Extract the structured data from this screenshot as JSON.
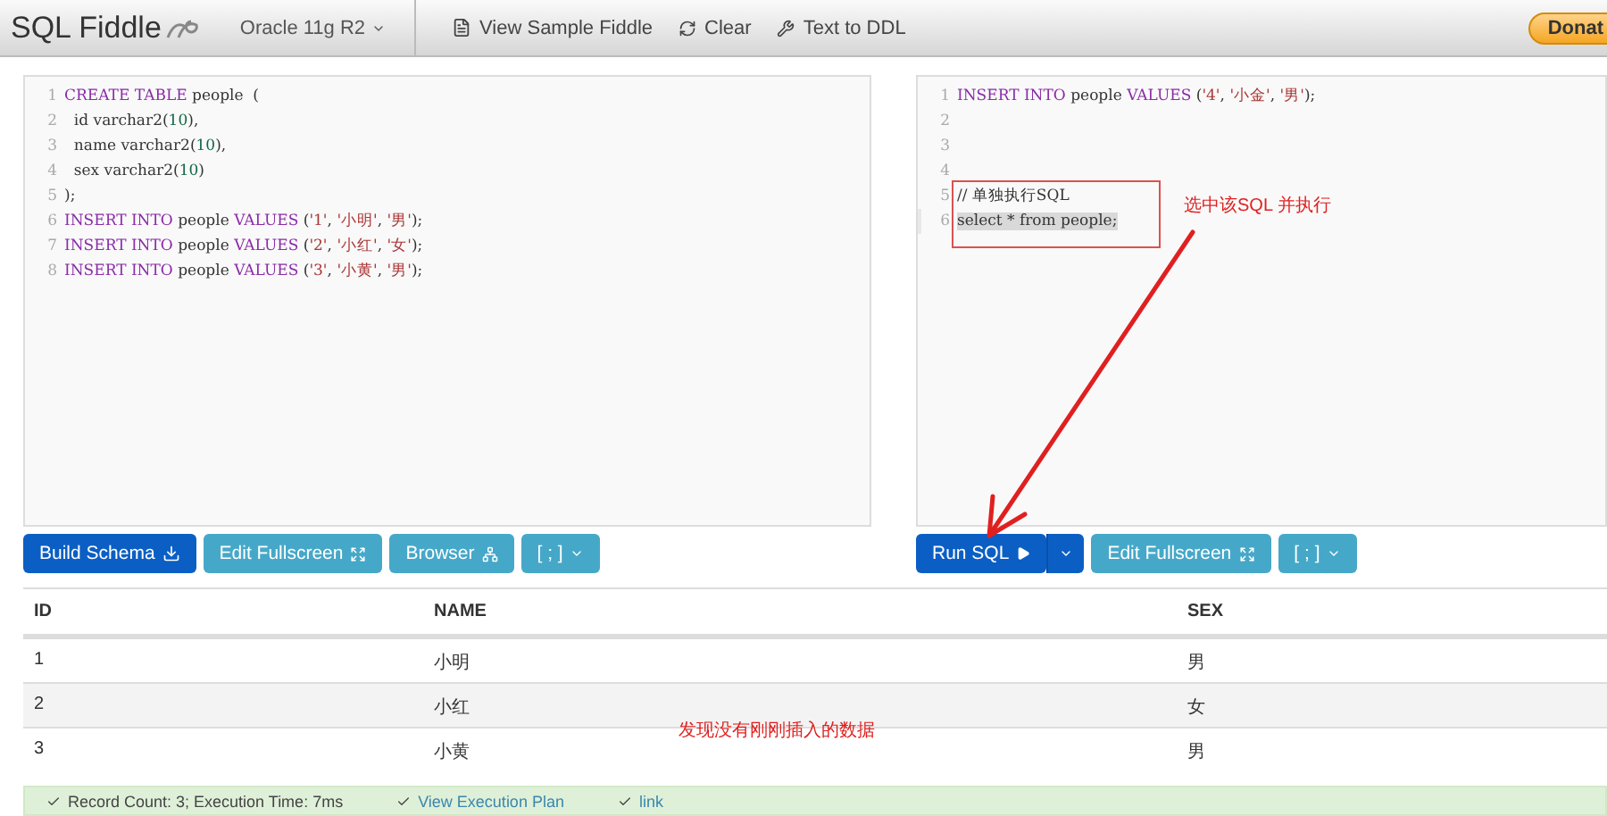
{
  "navbar": {
    "brand": "SQL Fiddle",
    "database": "Oracle 11g R2",
    "links": [
      {
        "kind": "sample",
        "label": "View Sample Fiddle"
      },
      {
        "kind": "clear",
        "label": "Clear"
      },
      {
        "kind": "ddl",
        "label": "Text to DDL"
      }
    ],
    "donate": "Donat"
  },
  "schema_panel": {
    "lines": [
      {
        "number": "1",
        "selected": false,
        "tokens": [
          {
            "kind": "keyword",
            "text": "CREATE TABLE"
          },
          {
            "kind": "plain",
            "text": " people  ("
          }
        ]
      },
      {
        "number": "2",
        "selected": false,
        "tokens": [
          {
            "kind": "plain",
            "text": "  id varchar2("
          },
          {
            "kind": "number",
            "text": "10"
          },
          {
            "kind": "plain",
            "text": "),"
          }
        ]
      },
      {
        "number": "3",
        "selected": false,
        "tokens": [
          {
            "kind": "plain",
            "text": "  name varchar2("
          },
          {
            "kind": "number",
            "text": "10"
          },
          {
            "kind": "plain",
            "text": "),"
          }
        ]
      },
      {
        "number": "4",
        "selected": false,
        "tokens": [
          {
            "kind": "plain",
            "text": "  sex varchar2("
          },
          {
            "kind": "number",
            "text": "10"
          },
          {
            "kind": "plain",
            "text": ")"
          }
        ]
      },
      {
        "number": "5",
        "selected": false,
        "tokens": [
          {
            "kind": "plain",
            "text": ");"
          }
        ]
      },
      {
        "number": "6",
        "selected": false,
        "tokens": [
          {
            "kind": "keyword",
            "text": "INSERT INTO"
          },
          {
            "kind": "plain",
            "text": " people "
          },
          {
            "kind": "keyword",
            "text": "VALUES"
          },
          {
            "kind": "plain",
            "text": " ("
          },
          {
            "kind": "string",
            "text": "'1'"
          },
          {
            "kind": "plain",
            "text": ", "
          },
          {
            "kind": "string",
            "text": "'小明'"
          },
          {
            "kind": "plain",
            "text": ", "
          },
          {
            "kind": "string",
            "text": "'男'"
          },
          {
            "kind": "plain",
            "text": ");"
          }
        ]
      },
      {
        "number": "7",
        "selected": false,
        "tokens": [
          {
            "kind": "keyword",
            "text": "INSERT INTO"
          },
          {
            "kind": "plain",
            "text": " people "
          },
          {
            "kind": "keyword",
            "text": "VALUES"
          },
          {
            "kind": "plain",
            "text": " ("
          },
          {
            "kind": "string",
            "text": "'2'"
          },
          {
            "kind": "plain",
            "text": ", "
          },
          {
            "kind": "string",
            "text": "'小红'"
          },
          {
            "kind": "plain",
            "text": ", "
          },
          {
            "kind": "string",
            "text": "'女'"
          },
          {
            "kind": "plain",
            "text": ");"
          }
        ]
      },
      {
        "number": "8",
        "selected": false,
        "tokens": [
          {
            "kind": "keyword",
            "text": "INSERT INTO"
          },
          {
            "kind": "plain",
            "text": " people "
          },
          {
            "kind": "keyword",
            "text": "VALUES"
          },
          {
            "kind": "plain",
            "text": " ("
          },
          {
            "kind": "string",
            "text": "'3'"
          },
          {
            "kind": "plain",
            "text": ", "
          },
          {
            "kind": "string",
            "text": "'小黄'"
          },
          {
            "kind": "plain",
            "text": ", "
          },
          {
            "kind": "string",
            "text": "'男'"
          },
          {
            "kind": "plain",
            "text": ");"
          }
        ]
      }
    ],
    "buttons": [
      {
        "kind": "build",
        "label": "Build Schema"
      },
      {
        "kind": "fullscreen",
        "label": "Edit Fullscreen"
      },
      {
        "kind": "browser",
        "label": "Browser"
      },
      {
        "kind": "dropdown",
        "label": "[ ; ]"
      }
    ]
  },
  "query_panel": {
    "lines": [
      {
        "number": "1",
        "selected": false,
        "tokens": [
          {
            "kind": "keyword",
            "text": "INSERT INTO"
          },
          {
            "kind": "plain",
            "text": " people "
          },
          {
            "kind": "keyword",
            "text": "VALUES"
          },
          {
            "kind": "plain",
            "text": " ("
          },
          {
            "kind": "string",
            "text": "'4'"
          },
          {
            "kind": "plain",
            "text": ", "
          },
          {
            "kind": "string",
            "text": "'小金'"
          },
          {
            "kind": "plain",
            "text": ", "
          },
          {
            "kind": "string",
            "text": "'男'"
          },
          {
            "kind": "plain",
            "text": ");"
          }
        ]
      },
      {
        "number": "2",
        "selected": false
      },
      {
        "number": "3",
        "selected": false
      },
      {
        "number": "4",
        "selected": false
      },
      {
        "number": "5",
        "selected": false,
        "tokens": [
          {
            "kind": "plain",
            "text": "// 单独执行SQL"
          }
        ]
      },
      {
        "number": "6",
        "selected": true,
        "tokens": [
          {
            "kind": "plain",
            "text": "select * from people;"
          }
        ]
      }
    ],
    "annotation": "选中该SQL 并执行",
    "buttons": [
      {
        "kind": "run",
        "label": "Run SQL"
      },
      {
        "kind": "split"
      },
      {
        "kind": "fullscreen",
        "label": "Edit Fullscreen"
      },
      {
        "kind": "dropdown",
        "label": "[ ; ]"
      }
    ]
  },
  "results": {
    "columns": [
      "ID",
      "NAME",
      "SEX"
    ],
    "rows": [
      [
        "1",
        "小明",
        "男"
      ],
      [
        "2",
        "小红",
        "女"
      ],
      [
        "3",
        "小黄",
        "男"
      ]
    ],
    "annotation": "发现没有刚刚插入的数据"
  },
  "status_bar": {
    "summary": "Record Count: 3; Execution Time: 7ms",
    "links": [
      "View Execution Plan",
      "link"
    ]
  }
}
